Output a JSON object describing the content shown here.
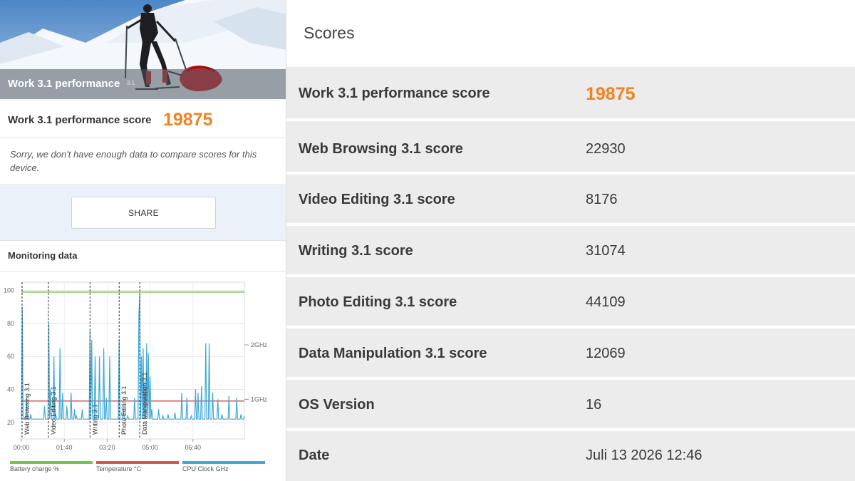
{
  "left": {
    "hero_title": "Work 3.1 performance",
    "hero_sup": "3.1",
    "score_label": "Work 3.1 performance score",
    "score_value": "19875",
    "sorry_text": "Sorry, we don't have enough data to compare scores for this device.",
    "share_label": "SHARE",
    "monitor_title": "Monitoring data"
  },
  "chart_data": {
    "type": "line",
    "title": "",
    "x_ticks": [
      "00:00",
      "01:40",
      "03:20",
      "05:00",
      "06:40"
    ],
    "x_range_seconds": [
      0,
      520
    ],
    "y_left_ticks": [
      20,
      40,
      60,
      80,
      100
    ],
    "y_left_range": [
      10,
      105
    ],
    "y_right_ticks": [
      "1GHz",
      "2GHz"
    ],
    "grid": true,
    "phases": [
      {
        "label": "Web Browsing 3.1",
        "start": 0
      },
      {
        "label": "Video Editing 3.1",
        "start": 63
      },
      {
        "label": "Writing 3.1",
        "start": 160
      },
      {
        "label": "Photo Editing 3.1",
        "start": 228
      },
      {
        "label": "Data Manipulation 3.1",
        "start": 276
      }
    ],
    "series": [
      {
        "name": "Battery charge %",
        "color": "#72c44a",
        "points": [
          [
            0,
            99
          ],
          [
            520,
            99
          ]
        ]
      },
      {
        "name": "Temperature °C",
        "color": "#d9534f",
        "points": [
          [
            0,
            33
          ],
          [
            520,
            33
          ]
        ]
      },
      {
        "name": "CPU Clock GHz",
        "color": "#3fa9d8",
        "points": [
          [
            0,
            22
          ],
          [
            2,
            90
          ],
          [
            4,
            22
          ],
          [
            10,
            22
          ],
          [
            12,
            35
          ],
          [
            14,
            22
          ],
          [
            20,
            22
          ],
          [
            22,
            25
          ],
          [
            24,
            22
          ],
          [
            52,
            22
          ],
          [
            54,
            30
          ],
          [
            56,
            22
          ],
          [
            62,
            22
          ],
          [
            64,
            80
          ],
          [
            66,
            22
          ],
          [
            68,
            40
          ],
          [
            70,
            22
          ],
          [
            74,
            22
          ],
          [
            76,
            60
          ],
          [
            78,
            22
          ],
          [
            80,
            25
          ],
          [
            82,
            22
          ],
          [
            88,
            22
          ],
          [
            90,
            65
          ],
          [
            92,
            22
          ],
          [
            94,
            22
          ],
          [
            96,
            38
          ],
          [
            98,
            22
          ],
          [
            104,
            22
          ],
          [
            106,
            30
          ],
          [
            108,
            22
          ],
          [
            114,
            22
          ],
          [
            116,
            38
          ],
          [
            118,
            22
          ],
          [
            122,
            22
          ],
          [
            124,
            28
          ],
          [
            126,
            22
          ],
          [
            128,
            24
          ],
          [
            130,
            22
          ],
          [
            140,
            22
          ],
          [
            142,
            28
          ],
          [
            144,
            22
          ],
          [
            158,
            22
          ],
          [
            160,
            76
          ],
          [
            162,
            22
          ],
          [
            164,
            70
          ],
          [
            166,
            22
          ],
          [
            170,
            22
          ],
          [
            172,
            60
          ],
          [
            174,
            22
          ],
          [
            180,
            22
          ],
          [
            182,
            60
          ],
          [
            184,
            22
          ],
          [
            190,
            22
          ],
          [
            192,
            65
          ],
          [
            194,
            22
          ],
          [
            196,
            22
          ],
          [
            198,
            35
          ],
          [
            200,
            22
          ],
          [
            204,
            22
          ],
          [
            206,
            60
          ],
          [
            208,
            22
          ],
          [
            226,
            22
          ],
          [
            228,
            70
          ],
          [
            230,
            22
          ],
          [
            236,
            22
          ],
          [
            238,
            28
          ],
          [
            240,
            22
          ],
          [
            246,
            22
          ],
          [
            248,
            24
          ],
          [
            250,
            22
          ],
          [
            262,
            22
          ],
          [
            264,
            35
          ],
          [
            266,
            22
          ],
          [
            272,
            22
          ],
          [
            274,
            85
          ],
          [
            276,
            98
          ],
          [
            278,
            22
          ],
          [
            280,
            60
          ],
          [
            282,
            22
          ],
          [
            284,
            65
          ],
          [
            286,
            22
          ],
          [
            288,
            45
          ],
          [
            290,
            22
          ],
          [
            292,
            68
          ],
          [
            294,
            22
          ],
          [
            296,
            62
          ],
          [
            298,
            22
          ],
          [
            300,
            48
          ],
          [
            302,
            22
          ],
          [
            304,
            28
          ],
          [
            306,
            22
          ],
          [
            318,
            22
          ],
          [
            320,
            28
          ],
          [
            322,
            22
          ],
          [
            328,
            22
          ],
          [
            330,
            24
          ],
          [
            332,
            22
          ],
          [
            340,
            22
          ],
          [
            342,
            25
          ],
          [
            344,
            22
          ],
          [
            356,
            22
          ],
          [
            358,
            26
          ],
          [
            360,
            22
          ],
          [
            372,
            22
          ],
          [
            374,
            38
          ],
          [
            376,
            22
          ],
          [
            384,
            22
          ],
          [
            386,
            35
          ],
          [
            388,
            22
          ],
          [
            394,
            22
          ],
          [
            396,
            24
          ],
          [
            398,
            22
          ],
          [
            404,
            22
          ],
          [
            406,
            40
          ],
          [
            408,
            22
          ],
          [
            410,
            22
          ],
          [
            412,
            38
          ],
          [
            414,
            22
          ],
          [
            418,
            22
          ],
          [
            420,
            42
          ],
          [
            422,
            22
          ],
          [
            428,
            22
          ],
          [
            430,
            68
          ],
          [
            432,
            22
          ],
          [
            436,
            22
          ],
          [
            438,
            68
          ],
          [
            440,
            22
          ],
          [
            444,
            22
          ],
          [
            446,
            38
          ],
          [
            448,
            22
          ],
          [
            456,
            22
          ],
          [
            458,
            34
          ],
          [
            460,
            22
          ],
          [
            466,
            22
          ],
          [
            468,
            25
          ],
          [
            470,
            22
          ],
          [
            482,
            22
          ],
          [
            484,
            36
          ],
          [
            486,
            22
          ],
          [
            500,
            22
          ],
          [
            502,
            35
          ],
          [
            504,
            22
          ],
          [
            510,
            22
          ],
          [
            512,
            25
          ],
          [
            514,
            22
          ],
          [
            518,
            22
          ],
          [
            520,
            24
          ]
        ]
      }
    ]
  },
  "scores": {
    "title": "Scores",
    "rows": [
      {
        "label": "Work 3.1 performance score",
        "value": "19875"
      },
      {
        "label": "Web Browsing 3.1 score",
        "value": "22930"
      },
      {
        "label": "Video Editing 3.1 score",
        "value": "8176"
      },
      {
        "label": "Writing 3.1 score",
        "value": "31074"
      },
      {
        "label": "Photo Editing 3.1 score",
        "value": "44109"
      },
      {
        "label": "Data Manipulation 3.1 score",
        "value": "12069"
      },
      {
        "label": "OS Version",
        "value": "16"
      },
      {
        "label": "Date",
        "value": "Juli 13 2026 12:46"
      }
    ]
  },
  "colors": {
    "accent": "#f58021",
    "battery": "#72c44a",
    "temperature": "#d9534f",
    "cpu": "#3fa9d8"
  }
}
